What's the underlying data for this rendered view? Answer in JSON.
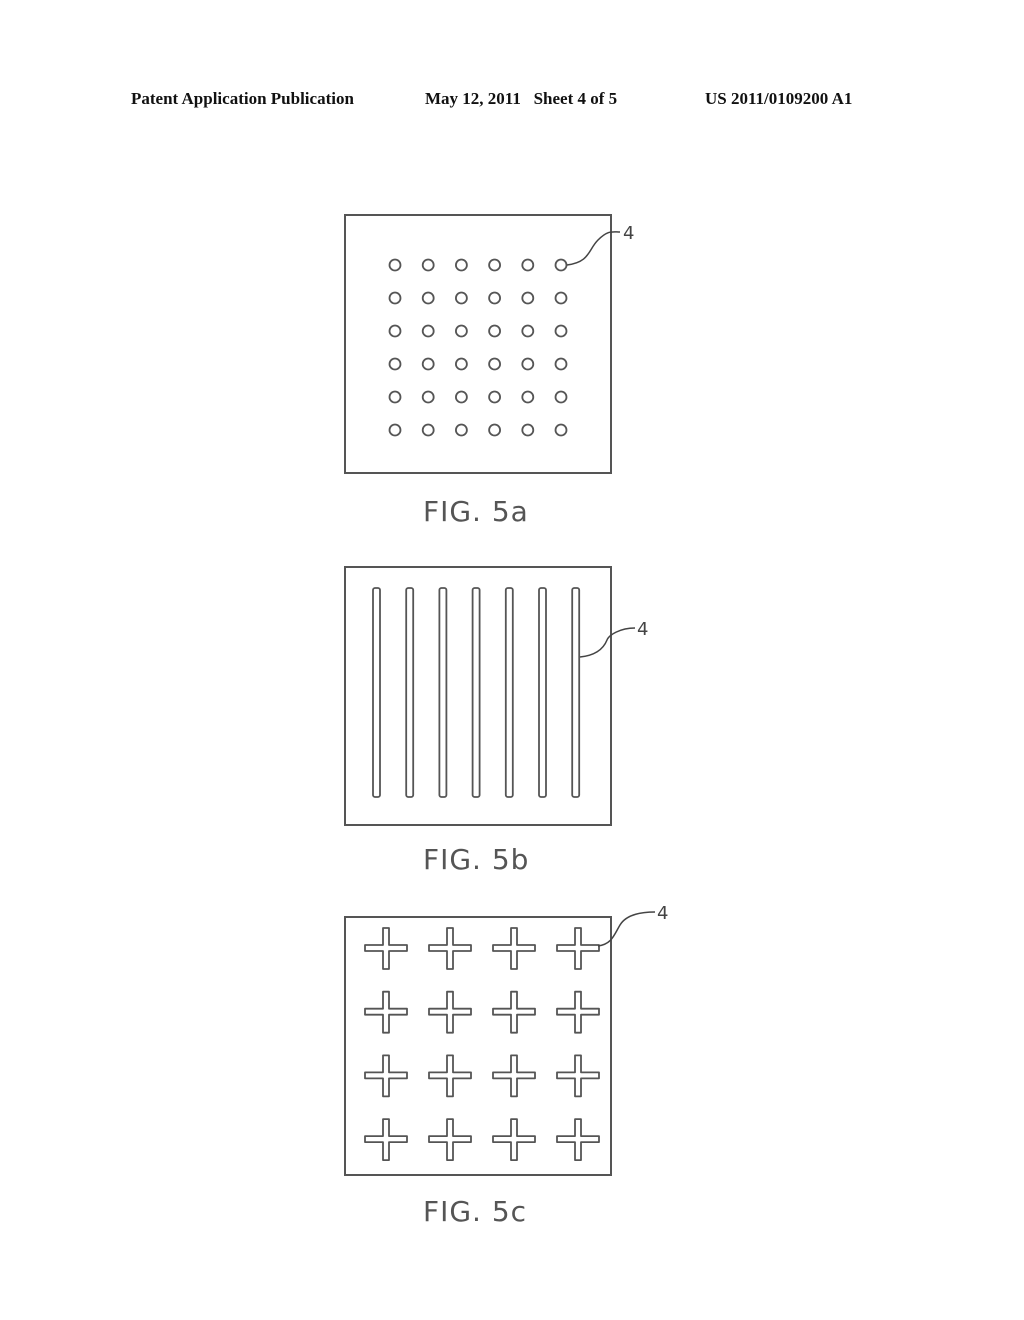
{
  "header": {
    "publication": "Patent Application Publication",
    "date_sheet": "May 12, 2011   Sheet 4 of 5",
    "number": "US 2011/0109200 A1"
  },
  "figures": [
    {
      "id": "5a",
      "caption": "FIG. 5a",
      "pattern": "circles",
      "rows": 6,
      "cols": 6,
      "reference": "4"
    },
    {
      "id": "5b",
      "caption": "FIG. 5b",
      "pattern": "vertical-slots",
      "count": 7,
      "reference": "4"
    },
    {
      "id": "5c",
      "caption": "FIG. 5c",
      "pattern": "crosses",
      "rows": 4,
      "cols": 4,
      "reference": "4"
    }
  ],
  "colors": {
    "line": "#555555"
  }
}
